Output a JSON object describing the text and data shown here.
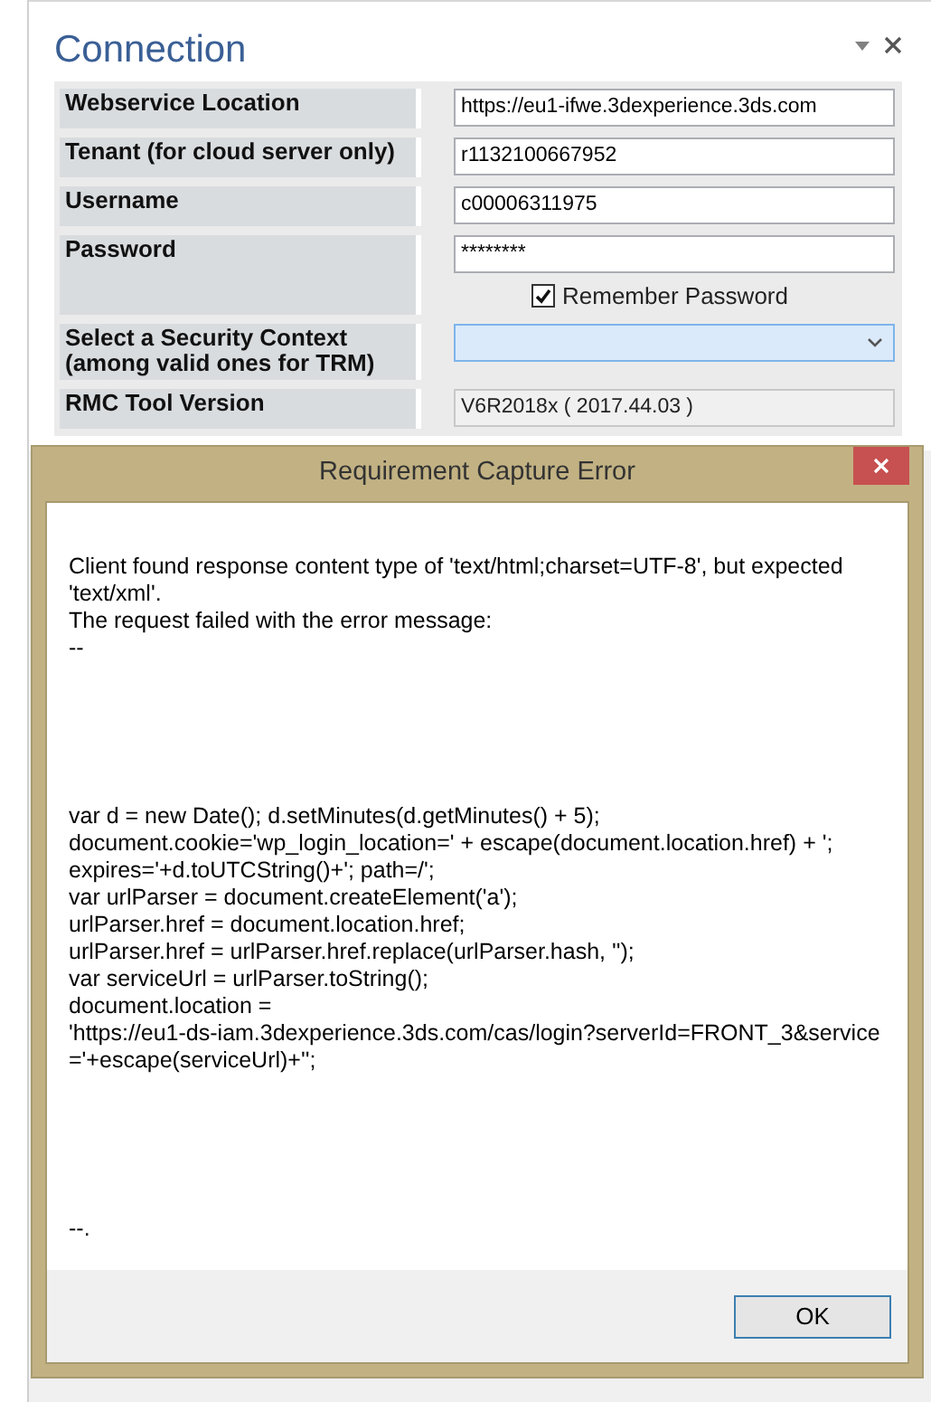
{
  "panel": {
    "title": "Connection"
  },
  "fields": [
    {
      "kind": "text",
      "label": "Webservice Location",
      "value": "https://eu1-ifwe.3dexperience.3ds.com"
    },
    {
      "kind": "text",
      "label": "Tenant (for cloud server only)",
      "value": "r1132100667952"
    },
    {
      "kind": "text",
      "label": "Username",
      "value": "c00006311975"
    },
    {
      "kind": "password",
      "label": "Password",
      "value": "********",
      "remember": {
        "label": "Remember Password",
        "checked": true
      }
    },
    {
      "kind": "select",
      "label": "Select a Security Context (among valid ones for TRM)",
      "focused": true
    },
    {
      "kind": "readonly",
      "label": "RMC Tool Version",
      "value": "V6R2018x ( 2017.44.03 )"
    }
  ],
  "dialog": {
    "title": "Requirement Capture Error",
    "message_blocks": [
      {
        "lines": [
          "Client found response content type of 'text/html;charset=UTF-8', but expected",
          "'text/xml'.",
          "The request failed with the error message:",
          "--"
        ]
      },
      {
        "lines": [
          "var d = new Date(); d.setMinutes(d.getMinutes() + 5);",
          "document.cookie='wp_login_location=' + escape(document.location.href) + ';",
          "expires='+d.toUTCString()+'; path=/';",
          "var urlParser = document.createElement('a');",
          "urlParser.href = document.location.href;",
          "urlParser.href = urlParser.href.replace(urlParser.hash, '');",
          "var serviceUrl = urlParser.toString();",
          "document.location =",
          "'https://eu1-ds-iam.3dexperience.3ds.com/cas/login?serverId=FRONT_3&service",
          "='+escape(serviceUrl)+'';"
        ]
      },
      {
        "lines": [
          "--."
        ]
      }
    ],
    "buttons": [
      "OK"
    ]
  }
}
